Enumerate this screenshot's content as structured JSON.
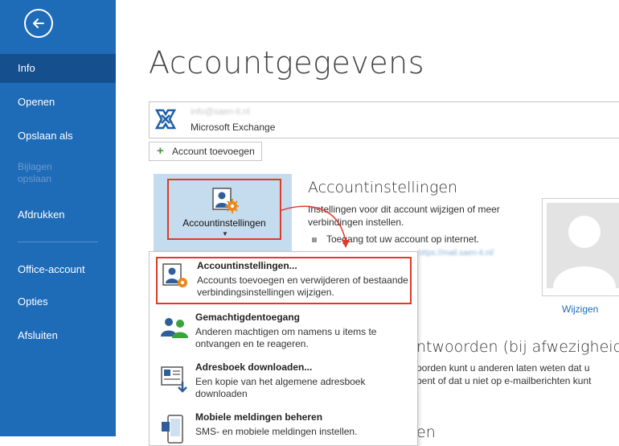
{
  "sidebar": {
    "back_icon": "back-arrow-icon",
    "items": [
      {
        "label": "Info",
        "active": true
      },
      {
        "label": "Openen"
      },
      {
        "label": "Opslaan als"
      },
      {
        "label": "Bijlagen opslaan",
        "disabled": true
      },
      {
        "label": "Afdrukken"
      },
      {
        "label": "Office-account"
      },
      {
        "label": "Opties"
      },
      {
        "label": "Afsluiten"
      }
    ]
  },
  "main": {
    "title": "Accountgegevens",
    "account": {
      "email": "info@saen-it.nl",
      "type": "Microsoft Exchange",
      "logo_icon": "exchange-logo-icon"
    },
    "add_account_label": "Account toevoegen",
    "settings_tile_label": "Accountinstellingen",
    "section": {
      "title": "Accountinstellingen",
      "description": "Instellingen voor dit account wijzigen of meer verbindingen instellen.",
      "bullet": "Toegang tot uw account op internet.",
      "blurred_link": "https://mail.saen-it.nl/"
    },
    "change_link": "Wijzigen",
    "background_text": {
      "heading": "ntwoorden (bij afwezigheid)",
      "line1": "oorden kunt u anderen laten weten dat u",
      "line2": "pent of dat u niet op e-mailberichten kunt",
      "heading2": "en"
    }
  },
  "dropdown": {
    "items": [
      {
        "title": "Accountinstellingen...",
        "desc": "Accounts toevoegen en verwijderen of bestaande verbindingsinstellingen wijzigen.",
        "icon": "account-settings-icon"
      },
      {
        "title": "Gemachtigdentoegang",
        "desc": "Anderen machtigen om namens u items te ontvangen en te reageren.",
        "icon": "delegate-access-icon"
      },
      {
        "title": "Adresboek downloaden...",
        "desc": "Een kopie van het algemene adresboek downloaden",
        "icon": "address-book-download-icon"
      },
      {
        "title": "Mobiele meldingen beheren",
        "desc": "SMS- en mobiele meldingen instellen.",
        "icon": "mobile-notifications-icon"
      }
    ]
  },
  "colors": {
    "sidebar": "#1e6bb8",
    "sidebar_active": "#154f8d",
    "highlight_red": "#e03a2a",
    "tile_bg": "#c5dbee"
  }
}
